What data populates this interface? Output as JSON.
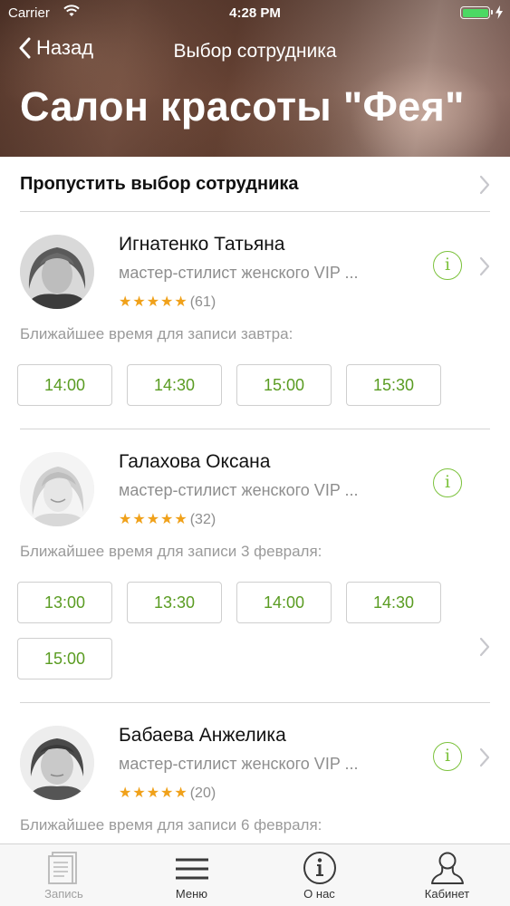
{
  "status_bar": {
    "carrier": "Carrier",
    "time": "4:28 PM"
  },
  "navbar": {
    "back_label": "Назад",
    "title": "Выбор сотрудника"
  },
  "salon": {
    "name": "Салон красоты \"Фея\""
  },
  "skip": {
    "label": "Пропустить выбор сотрудника"
  },
  "employees": [
    {
      "name": "Игнатенко Татьяна",
      "role": "мастер-стилист женского VIP ...",
      "stars": "★★★★★",
      "reviews": "(61)",
      "availability": "Ближайшее время для записи завтра:",
      "slots": [
        "14:00",
        "14:30",
        "15:00",
        "15:30"
      ]
    },
    {
      "name": "Галахова Оксана",
      "role": "мастер-стилист женского VIP ...",
      "stars": "★★★★★",
      "reviews": "(32)",
      "availability": "Ближайшее время для записи 3 февраля:",
      "slots": [
        "13:00",
        "13:30",
        "14:00",
        "14:30",
        "15:00"
      ]
    },
    {
      "name": "Бабаева Анжелика",
      "role": "мастер-стилист женского VIP ...",
      "stars": "★★★★★",
      "reviews": "(20)",
      "availability": "Ближайшее время для записи 6 февраля:",
      "slots": []
    }
  ],
  "tabbar": {
    "tabs": [
      {
        "label": "Запись",
        "icon": "document-icon",
        "active": false
      },
      {
        "label": "Меню",
        "icon": "menu-icon",
        "active": false
      },
      {
        "label": "О нас",
        "icon": "info-icon",
        "active": false
      },
      {
        "label": "Кабинет",
        "icon": "person-icon",
        "active": false
      }
    ]
  },
  "colors": {
    "accent_green": "#7cc23c",
    "slot_text": "#5a9c22",
    "star": "#f0a11a",
    "battery": "#4cd964"
  }
}
